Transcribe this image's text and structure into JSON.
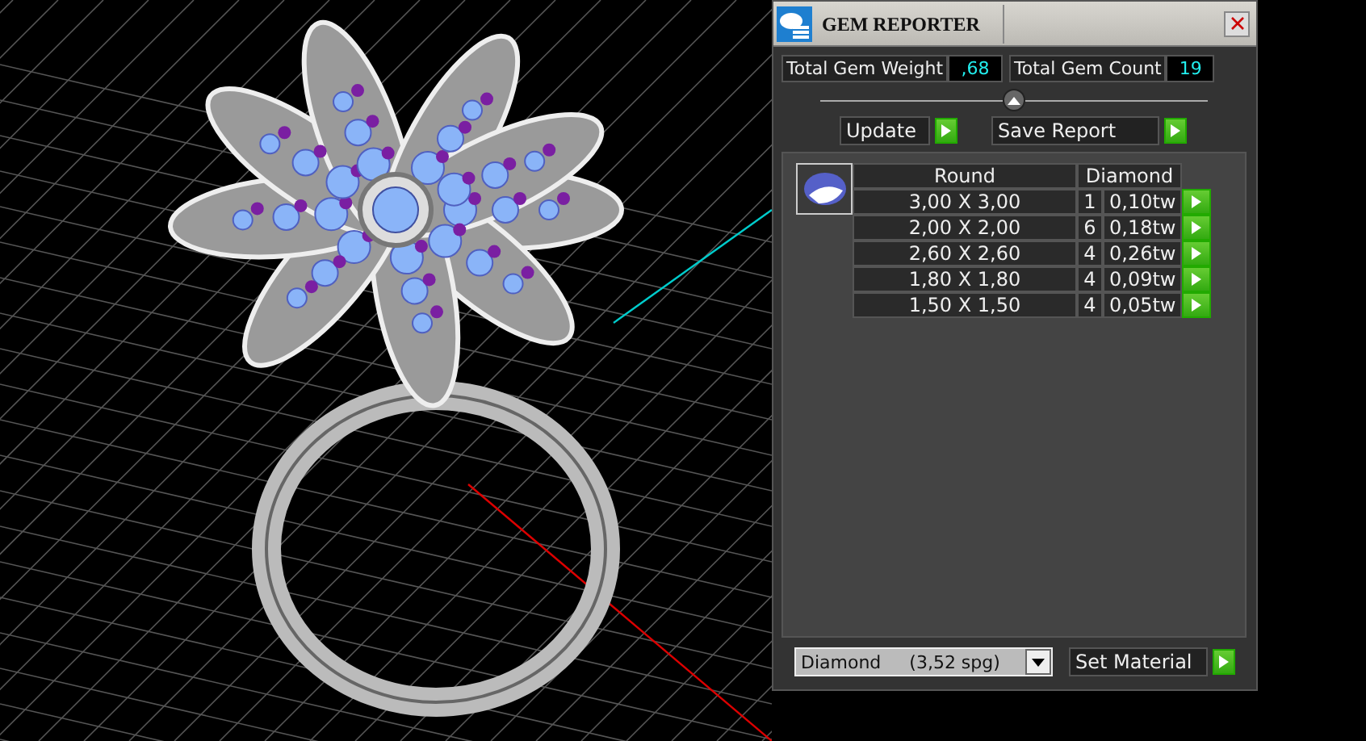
{
  "panel": {
    "title": "GEM REPORTER",
    "totals": [
      {
        "label": "Total Gem Weight",
        "value": ",68"
      },
      {
        "label": "Total Gem Count",
        "value": "19"
      }
    ],
    "actions": [
      {
        "label": "Update"
      },
      {
        "label": "Save Report"
      }
    ],
    "table": {
      "columns": [
        "Round",
        "Diamond"
      ],
      "rows": [
        {
          "size": "3,00 X 3,00",
          "count": "1",
          "weight": "0,10tw"
        },
        {
          "size": "2,00 X 2,00",
          "count": "6",
          "weight": "0,18tw"
        },
        {
          "size": "2,60 X 2,60",
          "count": "4",
          "weight": "0,26tw"
        },
        {
          "size": "1,80 X 1,80",
          "count": "4",
          "weight": "0,09tw"
        },
        {
          "size": "1,50 X 1,50",
          "count": "4",
          "weight": "0,05tw"
        }
      ]
    },
    "material": {
      "value": "Diamond",
      "density": "(3,52 spg)"
    },
    "set_button": "Set Material"
  }
}
